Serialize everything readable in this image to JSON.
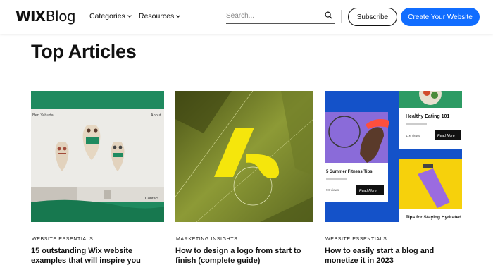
{
  "header": {
    "logo_wix": "WIX",
    "logo_blog": "Blog",
    "nav": [
      {
        "label": "Categories"
      },
      {
        "label": "Resources"
      }
    ],
    "search_placeholder": "Search...",
    "subscribe_label": "Subscribe",
    "create_label": "Create Your Website",
    "accent_color": "#116dff"
  },
  "main": {
    "section_title": "Top Articles",
    "cards": [
      {
        "category": "Website Essentials",
        "title": "15 outstanding Wix website examples that will inspire you",
        "thumb": {
          "left_label": "Ben Yehuda",
          "right_label": "About",
          "bottom_right_label": "Contact"
        }
      },
      {
        "category": "Marketing Insights",
        "title": "How to design a logo from start to finish (complete guide)"
      },
      {
        "category": "Website Essentials",
        "title": "How to easily start a blog and monetize it in 2023",
        "thumb": {
          "card_a_title": "Healthy Eating 101",
          "card_a_views": "11K views",
          "card_a_button": "Read More",
          "card_b_title": "5 Summer Fitness Tips",
          "card_b_views": "9K views",
          "card_b_button": "Read More",
          "card_c_title": "Tips for Staying Hydrated"
        }
      }
    ]
  }
}
